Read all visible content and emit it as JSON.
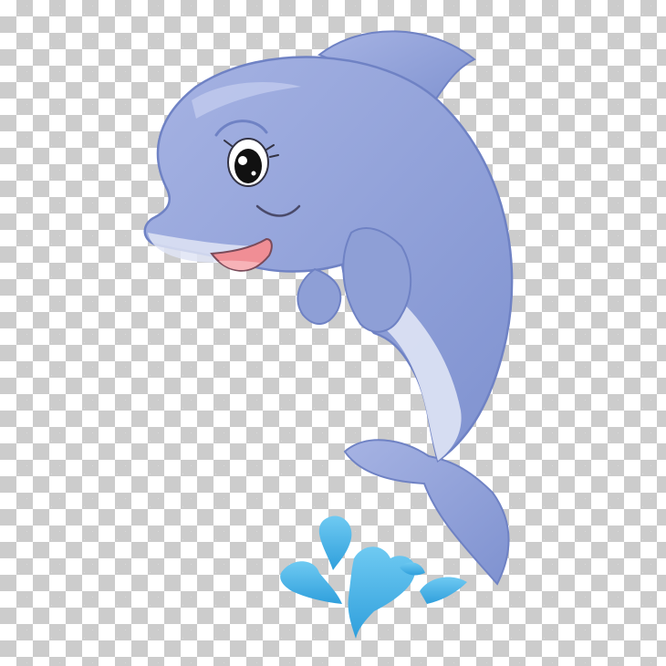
{
  "image": {
    "subject": "cartoon-dolphin",
    "background": "transparency-checkerboard"
  },
  "colors": {
    "checker_light": "#ffffff",
    "checker_dark": "#cccccc",
    "dolphin_body": "#8e9fd6",
    "dolphin_outline": "#6f82c4",
    "dolphin_belly": "#dfe4f5",
    "mouth": "#f08e95",
    "tongue": "#f7b3b8",
    "eye": "#111111",
    "water": "#45b3e8"
  }
}
